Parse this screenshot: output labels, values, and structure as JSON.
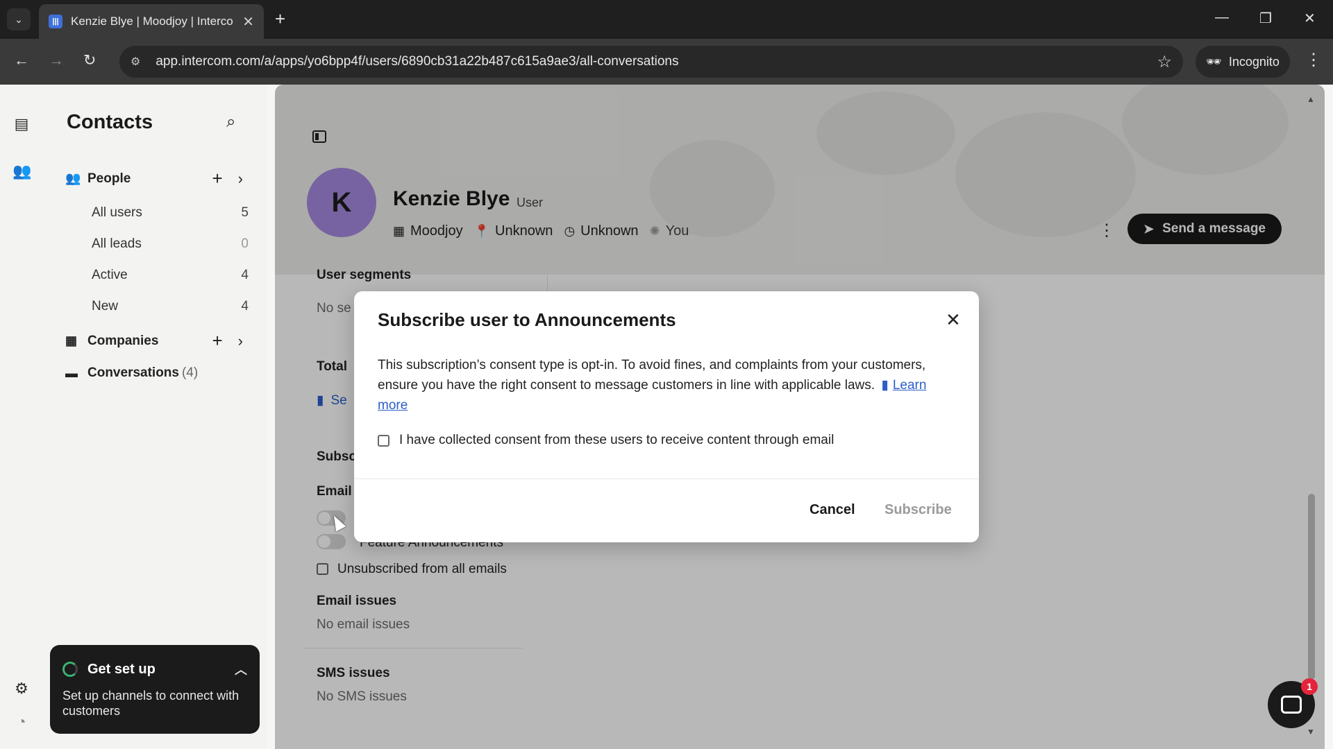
{
  "browser": {
    "tab_title": "Kenzie Blye | Moodjoy | Interco",
    "tab_close": "✕",
    "new_tab": "+",
    "url": "app.intercom.com/a/apps/yo6bpp4f/users/6890cb31a22b487c615a9ae3/all-conversations",
    "incognito_label": "Incognito"
  },
  "sidebar": {
    "title": "Contacts",
    "people_label": "People",
    "items": [
      {
        "label": "All users",
        "count": "5"
      },
      {
        "label": "All leads",
        "count": "0"
      },
      {
        "label": "Active",
        "count": "4"
      },
      {
        "label": "New",
        "count": "4"
      }
    ],
    "companies_label": "Companies",
    "conversations_label": "Conversations",
    "conversations_count": "(4)"
  },
  "get_set_up": {
    "title": "Get set up",
    "text": "Set up channels to connect with customers"
  },
  "profile": {
    "avatar_initial": "K",
    "name": "Kenzie Blye",
    "role": "User",
    "company": "Moodjoy",
    "location": "Unknown",
    "timezone": "Unknown",
    "owner": "You",
    "send_message_label": "Send a message"
  },
  "details": {
    "user_segments_heading": "User segments",
    "segments_value_partial": "No se",
    "total_partial": "Total",
    "see_partial": "Se",
    "subscriptions_partial": "Subsc",
    "email_partial": "Email",
    "toggle_2_label_partial": "Feature Announcements",
    "unsubscribed_label": "Unsubscribed from all emails",
    "email_issues_heading": "Email issues",
    "email_issues_value": "No email issues",
    "sms_issues_heading": "SMS issues",
    "sms_issues_value": "No SMS issues"
  },
  "modal": {
    "title": "Subscribe user to Announcements",
    "body": "This subscription’s consent type is opt-in. To avoid fines, and complaints from your customers, ensure you have the right consent to message customers in line with applicable laws.",
    "learn_more": "Learn more",
    "consent_label": "I have collected consent from these users to receive content through email",
    "cancel_label": "Cancel",
    "subscribe_label": "Subscribe"
  },
  "messenger": {
    "badge_count": "1"
  },
  "colors": {
    "avatar": "#a58ae0",
    "link": "#2b5ec9",
    "primary_button": "#1a1a1a",
    "badge": "#e5243b"
  }
}
